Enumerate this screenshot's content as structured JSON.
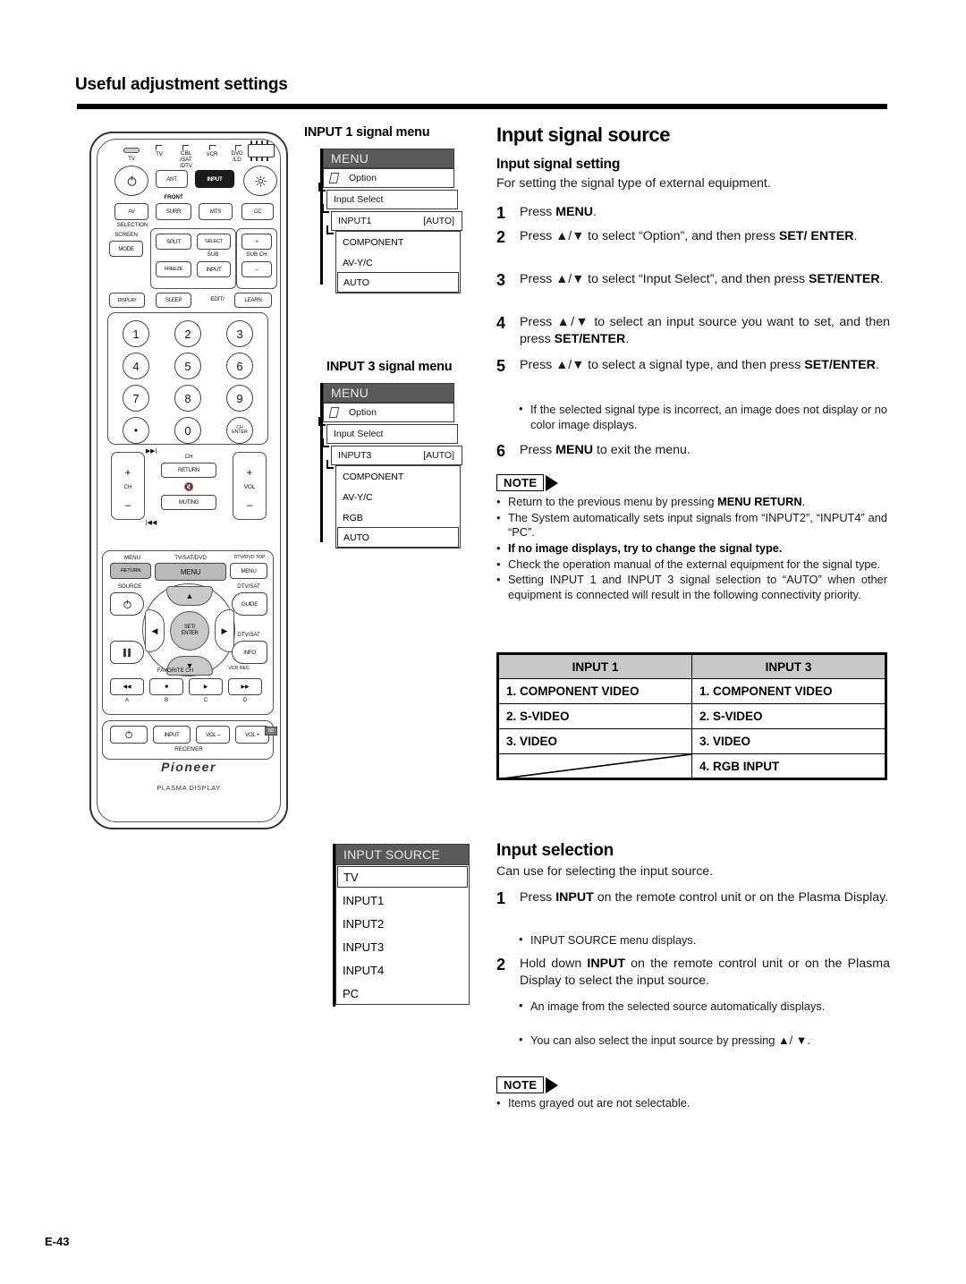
{
  "header": {
    "running_head": "Useful adjustment settings"
  },
  "footer": {
    "page_number": "E-43"
  },
  "remote": {
    "brand": "Pioneer",
    "brand_sub": "PLASMA DISPLAY",
    "device_labels": [
      "TV",
      "CBL\n/SAT\n/DTV",
      "VCR",
      "DVD\n/LD"
    ],
    "tv_label": "TV",
    "buttons": {
      "ant": "ANT",
      "input_top": "INPUT",
      "av": "AV",
      "av_sub": "SELECTION",
      "front": "FRONT",
      "surr": "SURR",
      "mts": "MTS",
      "cc": "CC",
      "screen": "SCREEN",
      "mode": "MODE",
      "split": "SPLIT",
      "select": "SELECT",
      "sub": "SUB",
      "sub_input": "INPUT",
      "sub_ch": "SUB CH",
      "plus": "+",
      "minus": "–",
      "display": "DISPLAY",
      "sleep": "SLEEP",
      "edit": "EDIT/",
      "learn": "LEARN",
      "ch": "CH",
      "vol": "VOL",
      "ch_return_top": "CH",
      "ch_return": "RETURN",
      "muting": "MUTING",
      "dot": "•",
      "ch_enter": "CH\nENTER",
      "menu_return_top": "MENU",
      "menu_return": "RETURN",
      "tv_sat_dvd": "TV/SAT/DVD",
      "menu_center": "MENU",
      "dtv_dvd_top": "DTV/DVD TOP",
      "menu_right": "MENU",
      "source": "SOURCE",
      "dtv_sat_1": "DTV/SAT",
      "guide": "GUIDE",
      "set_enter": "SET/\nENTER",
      "dtv_sat_2": "DTV/SAT",
      "info": "INFO",
      "favorite_ch": "FAVORITE CH",
      "vcr_rec": "VCR REC",
      "abcd": [
        "A",
        "B",
        "C",
        "D"
      ],
      "receiver": "RECEIVER",
      "receiver_input": "INPUT",
      "vol_minus": "VOL –",
      "vol_plus": "VOL +"
    },
    "numbers": [
      "1",
      "2",
      "3",
      "4",
      "5",
      "6",
      "7",
      "8",
      "9",
      "0"
    ]
  },
  "diagrams": [
    {
      "title": "INPUT 1 signal menu",
      "menu_header": "MENU",
      "option_label": "Option",
      "input_select_label": "Input Select",
      "input_label": "INPUT1",
      "input_value": "[AUTO]",
      "signal_types": [
        "COMPONENT",
        "AV-Y/C",
        "AUTO"
      ],
      "selected_signal": "AUTO"
    },
    {
      "title": "INPUT 3 signal menu",
      "menu_header": "MENU",
      "option_label": "Option",
      "input_select_label": "Input Select",
      "input_label": "INPUT3",
      "input_value": "[AUTO]",
      "signal_types": [
        "COMPONENT",
        "AV-Y/C",
        "RGB",
        "AUTO"
      ],
      "selected_signal": "AUTO"
    }
  ],
  "input_source_menu": {
    "header": "INPUT SOURCE",
    "items": [
      "TV",
      "INPUT1",
      "INPUT2",
      "INPUT3",
      "INPUT4",
      "PC"
    ],
    "selected": "TV"
  },
  "main": {
    "title": "Input signal source",
    "section1": {
      "heading": "Input signal setting",
      "intro": "For setting the signal type of external equipment.",
      "steps": [
        {
          "n": "1",
          "parts": [
            {
              "t": "Press ",
              "b": false
            },
            {
              "t": "MENU",
              "b": true
            },
            {
              "t": ".",
              "b": false
            }
          ]
        },
        {
          "n": "2",
          "parts": [
            {
              "t": "Press ▲/▼ to select “Option”, and then press ",
              "b": false
            },
            {
              "t": "SET/ ENTER",
              "b": true
            },
            {
              "t": ".",
              "b": false
            }
          ]
        },
        {
          "n": "3",
          "parts": [
            {
              "t": "Press ▲/▼ to select “Input Select”, and then press ",
              "b": false
            },
            {
              "t": "SET/ENTER",
              "b": true
            },
            {
              "t": ".",
              "b": false
            }
          ]
        },
        {
          "n": "4",
          "parts": [
            {
              "t": "Press ▲/▼ to select an input source you want to set, and then press ",
              "b": false
            },
            {
              "t": "SET/ENTER",
              "b": true
            },
            {
              "t": ".",
              "b": false
            }
          ]
        },
        {
          "n": "5",
          "parts": [
            {
              "t": "Press ▲/▼ to select a signal type, and then press ",
              "b": false
            },
            {
              "t": "SET/ENTER",
              "b": true
            },
            {
              "t": ".",
              "b": false
            }
          ]
        },
        {
          "n": "6",
          "parts": [
            {
              "t": "Press ",
              "b": false
            },
            {
              "t": "MENU",
              "b": true
            },
            {
              "t": " to exit the menu.",
              "b": false
            }
          ]
        }
      ],
      "step5_bullet": "If the selected signal type is incorrect, an image does not display or no color image displays.",
      "note_label": "NOTE",
      "notes": [
        "Return to the previous menu by pressing MENU RETURN.",
        "The System automatically sets input signals from “INPUT2”, “INPUT4” and “PC”.",
        "If no image displays, try to change the signal type.",
        "Check the operation manual of the external equipment for the signal type.",
        "Setting INPUT 1 and INPUT 3 signal selection to “AUTO” when other equipment is connected will result in the following connectivity priority."
      ]
    },
    "priority_table": {
      "headers": [
        "INPUT 1",
        "INPUT 3"
      ],
      "rows": [
        [
          "1. COMPONENT VIDEO",
          "1. COMPONENT VIDEO"
        ],
        [
          "2. S-VIDEO",
          "2. S-VIDEO"
        ],
        [
          "3. VIDEO",
          "3. VIDEO"
        ],
        [
          "",
          "4. RGB INPUT"
        ]
      ]
    },
    "section2": {
      "heading": "Input selection",
      "intro": "Can use for selecting the input source.",
      "steps": [
        {
          "n": "1",
          "parts": [
            {
              "t": "Press ",
              "b": false
            },
            {
              "t": "INPUT",
              "b": true
            },
            {
              "t": " on the remote control unit or on the Plasma Display.",
              "b": false
            }
          ]
        },
        {
          "n": "2",
          "parts": [
            {
              "t": "Hold down ",
              "b": false
            },
            {
              "t": "INPUT",
              "b": true
            },
            {
              "t": " on the remote control unit or on the Plasma Display to select the input source.",
              "b": false
            }
          ]
        }
      ],
      "step1_bullet": "INPUT SOURCE menu displays.",
      "step2_bullets": [
        "An image from the selected source automatically displays.",
        "You can also select the input source by pressing ▲/ ▼."
      ],
      "note_label": "NOTE",
      "notes": [
        "Items grayed out are not selectable."
      ]
    }
  },
  "colors": {
    "osd_header_bg": "#5a5a5a",
    "table_header_bg": "#c8c8c8",
    "rule": "#000000"
  }
}
